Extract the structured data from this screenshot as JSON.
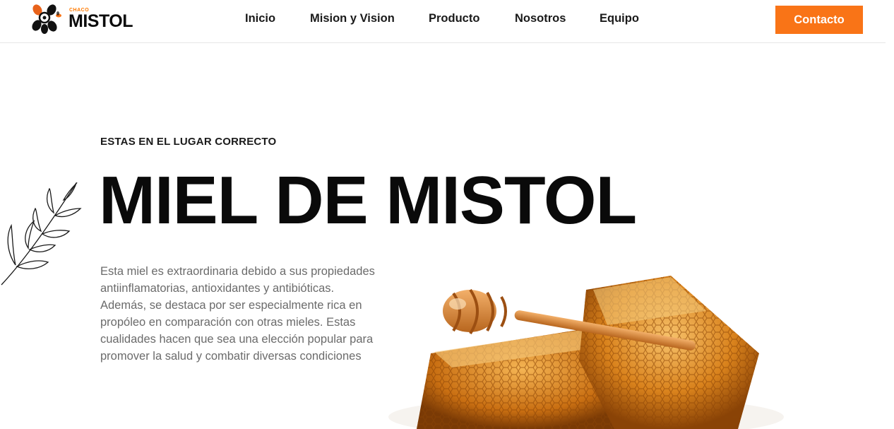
{
  "header": {
    "logo": {
      "small_text": "CHACO",
      "brand_text": "MISTOL",
      "icon": "bee-flower-icon"
    },
    "nav": [
      {
        "label": "Inicio"
      },
      {
        "label": "Mision y Vision"
      },
      {
        "label": "Producto"
      },
      {
        "label": "Nosotros"
      },
      {
        "label": "Equipo"
      }
    ],
    "cta_label": "Contacto"
  },
  "hero": {
    "eyebrow": "ESTAS EN EL LUGAR CORRECTO",
    "title": "MIEL DE MISTOL",
    "description": "Esta miel es extraordinaria debido a sus propiedades antiinflamatorias, antioxidantes y antibióticas. Además, se destaca por ser especialmente rica en propóleo en comparación con otras mieles. Estas cualidades hacen que sea una elección popular para promover la salud y combatir diversas condiciones",
    "decor_icon": "leaf-sprig-icon",
    "image": "honeycomb-with-dipper-image"
  },
  "colors": {
    "accent": "#f97417",
    "text": "#0a0a0a",
    "muted": "#6b6b6b"
  }
}
